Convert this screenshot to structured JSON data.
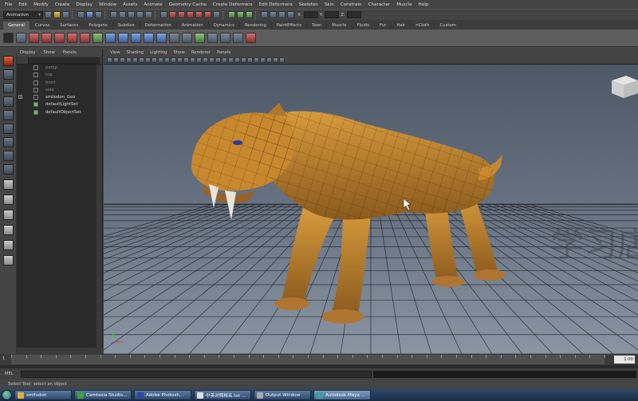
{
  "menu": [
    "File",
    "Edit",
    "Modify",
    "Create",
    "Display",
    "Window",
    "Assets",
    "Animate",
    "Geometry Cache",
    "Create Deformers",
    "Edit Deformers",
    "Skeleton",
    "Skin",
    "Constrain",
    "Character",
    "Muscle",
    "Help"
  ],
  "status_line": {
    "mode": "Animation",
    "x_label": "X:",
    "y_label": "Y:",
    "z_label": "Z:"
  },
  "shelf_tabs": [
    "General",
    "Curves",
    "Surfaces",
    "Polygons",
    "Subdivs",
    "Deformation",
    "Animation",
    "Dynamics",
    "Rendering",
    "PaintEffects",
    "Toon",
    "Muscle",
    "Fluids",
    "Fur",
    "Hair",
    "nCloth",
    "Custom"
  ],
  "active_shelf_tab": "General",
  "outliner": {
    "menu": [
      "Display",
      "Show",
      "Panels"
    ],
    "items": [
      {
        "label": "persp",
        "dim": true,
        "set": false,
        "expander": false
      },
      {
        "label": "top",
        "dim": true,
        "set": false,
        "expander": false
      },
      {
        "label": "front",
        "dim": true,
        "set": false,
        "expander": false
      },
      {
        "label": "side",
        "dim": true,
        "set": false,
        "expander": false
      },
      {
        "label": "smilodon_Geo",
        "dim": false,
        "set": false,
        "expander": true
      },
      {
        "label": "defaultLightSet",
        "dim": false,
        "set": true,
        "expander": false
      },
      {
        "label": "defaultObjectSet",
        "dim": false,
        "set": true,
        "expander": false
      }
    ]
  },
  "viewport": {
    "menu": [
      "View",
      "Shading",
      "Lighting",
      "Show",
      "Renderer",
      "Panels"
    ],
    "bg_top": "#4d5866",
    "bg_bottom": "#8a95a3",
    "model_color": "#c8882e",
    "watermark": "学习店"
  },
  "time_slider": {
    "start": "1",
    "end": "1.00"
  },
  "command_line": {
    "label": "MEL"
  },
  "help_line": "Select Tool: select an object",
  "taskbar": [
    {
      "label": "smilodon",
      "icon_color": "#e0b040"
    },
    {
      "label": "Camtasia Studio...",
      "icon_color": "#40a040"
    },
    {
      "label": "Adobe Photosh...",
      "icon_color": "#2a4aa0"
    },
    {
      "label": "中英对照释名.txt ...",
      "icon_color": "#ddd"
    },
    {
      "label": "Output Window",
      "icon_color": "#aaa"
    },
    {
      "label": "Autodesk Maya ...",
      "icon_color": "#3aa0a0"
    }
  ]
}
